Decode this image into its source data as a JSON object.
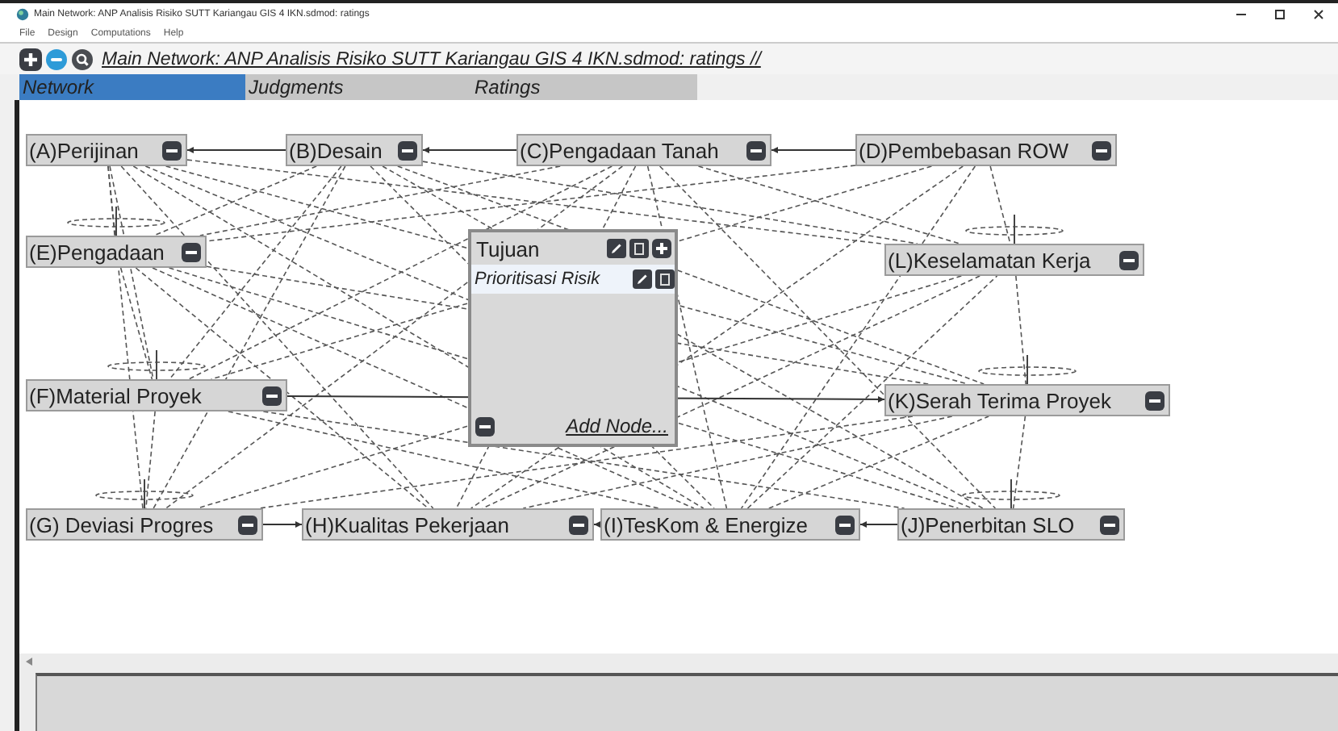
{
  "window": {
    "title": "Main Network: ANP Analisis Risiko SUTT Kariangau GIS 4 IKN.sdmod: ratings"
  },
  "menu": [
    "File",
    "Design",
    "Computations",
    "Help"
  ],
  "toolbar": {
    "path": "Main Network: ANP Analisis Risiko SUTT Kariangau GIS 4 IKN.sdmod: ratings //"
  },
  "tabs": [
    {
      "label": "Network",
      "selected": true
    },
    {
      "label": "Judgments",
      "selected": false
    },
    {
      "label": "Ratings",
      "selected": false
    }
  ],
  "nodes": [
    {
      "label": "(A)Perijinan"
    },
    {
      "label": "(B)Desain"
    },
    {
      "label": "(C)Pengadaan Tanah"
    },
    {
      "label": "(D)Pembebasan ROW"
    },
    {
      "label": "(E)Pengadaan"
    },
    {
      "label": "(L)Keselamatan Kerja"
    },
    {
      "label": "(F)Material Proyek"
    },
    {
      "label": "(K)Serah Terima Proyek"
    },
    {
      "label": "(G) Deviasi Progres"
    },
    {
      "label": "(H)Kualitas Pekerjaan"
    },
    {
      "label": "(I)TesKom & Energize"
    },
    {
      "label": "(J)Penerbitan SLO"
    }
  ],
  "goal_panel": {
    "title": "Tujuan",
    "items": [
      {
        "label": "Prioritisasi Risik"
      }
    ],
    "action": "Add Node..."
  }
}
